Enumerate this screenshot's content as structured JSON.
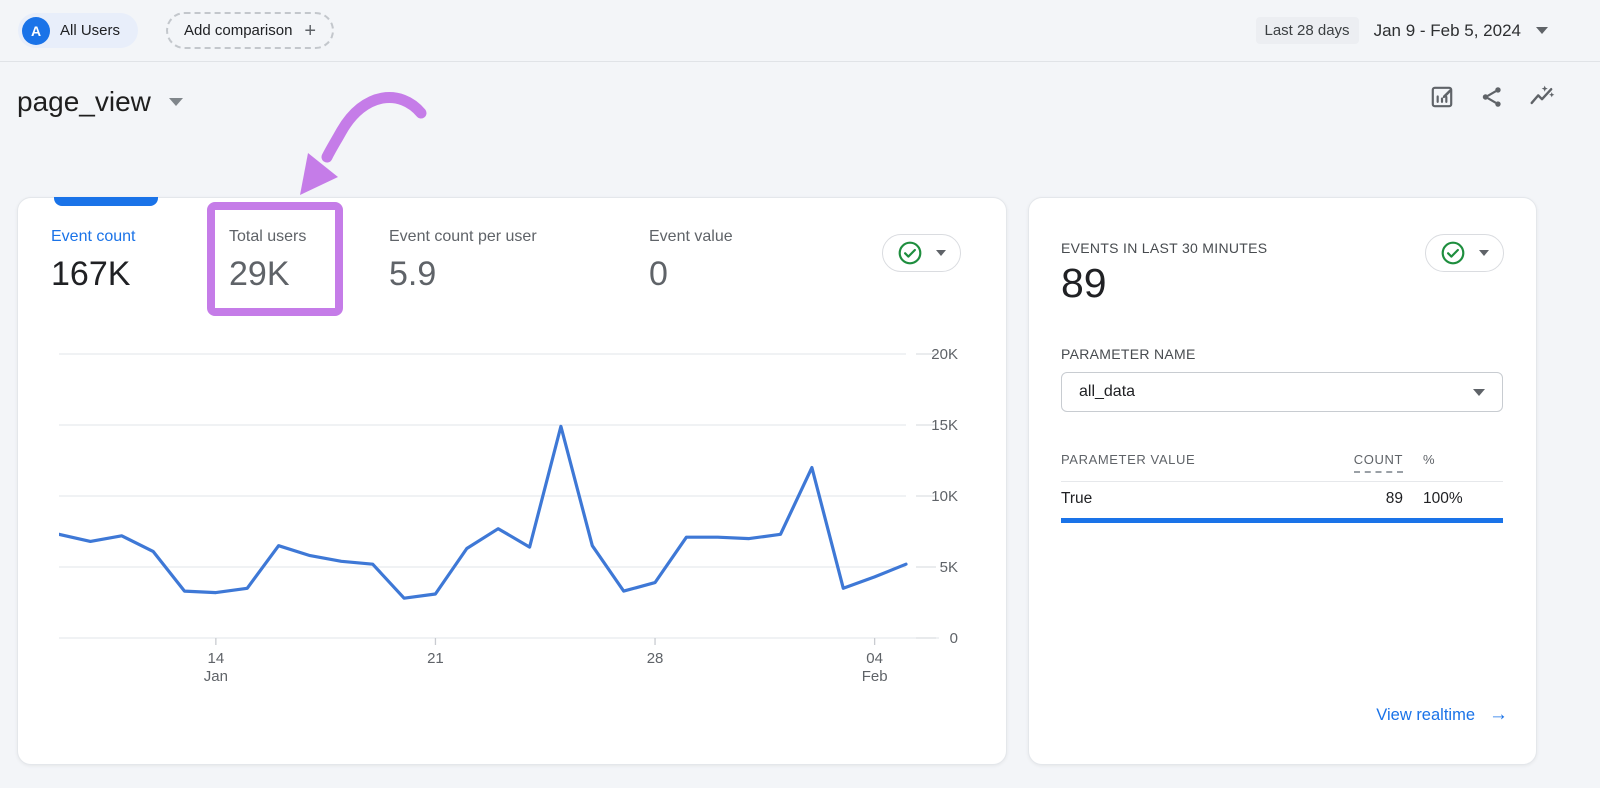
{
  "topbar": {
    "avatar_letter": "A",
    "audience_label": "All Users",
    "add_comparison_label": "Add comparison",
    "date_range_preset": "Last 28 days",
    "date_range": "Jan 9 - Feb 5, 2024"
  },
  "header": {
    "title": "page_view",
    "toolbar_icons": [
      "customize-report",
      "share",
      "insights"
    ]
  },
  "icons": {
    "plus": "+",
    "arrow_right": "→"
  },
  "metrics": {
    "tabs": [
      {
        "label": "Event count",
        "value": "167K",
        "selected": true
      },
      {
        "label": "Total users",
        "value": "29K",
        "highlighted": true
      },
      {
        "label": "Event count per user",
        "value": "5.9"
      },
      {
        "label": "Event value",
        "value": "0"
      }
    ]
  },
  "chart_data": {
    "type": "line",
    "series": [
      {
        "name": "Event count",
        "values": [
          7300,
          6800,
          7200,
          6100,
          3300,
          3200,
          3500,
          6500,
          5800,
          5400,
          5200,
          2800,
          3100,
          6300,
          7700,
          6400,
          14900,
          6500,
          3300,
          3900,
          7100,
          7100,
          7000,
          7300,
          12000,
          3500,
          4300,
          5200
        ]
      }
    ],
    "points": 28,
    "x_start": "Jan 9, 2024",
    "x_end": "Feb 5, 2024",
    "xticks": [
      {
        "day": "14",
        "month": "Jan",
        "index": 5
      },
      {
        "day": "21",
        "month": "",
        "index": 12
      },
      {
        "day": "28",
        "month": "",
        "index": 19
      },
      {
        "day": "04",
        "month": "Feb",
        "index": 26
      }
    ],
    "yticks": [
      "0",
      "5K",
      "10K",
      "15K",
      "20K"
    ],
    "ylim": [
      0,
      20000
    ],
    "grid": true,
    "legend": false,
    "line_color": "#3e78d6"
  },
  "realtime": {
    "title": "EVENTS IN LAST 30 MINUTES",
    "value": "89",
    "parameter_name_label": "PARAMETER NAME",
    "parameter_name_value": "all_data",
    "table": {
      "headers": [
        "PARAMETER VALUE",
        "COUNT",
        "%"
      ],
      "rows": [
        {
          "value": "True",
          "count": "89",
          "percent": "100%"
        }
      ]
    },
    "link_label": "View realtime"
  },
  "colors": {
    "accent_blue": "#1a73e8",
    "chart_line": "#3e78d6",
    "annotation_purple": "#c57ce8",
    "success_green": "#1e8e3e",
    "text_primary": "#202124",
    "text_secondary": "#5f6368"
  }
}
